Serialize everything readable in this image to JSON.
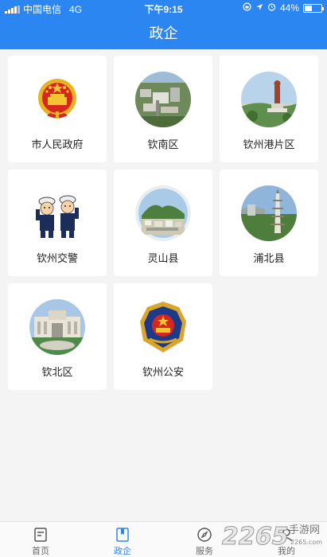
{
  "status_bar": {
    "carrier": "中国电信",
    "network": "4G",
    "time": "下午9:15",
    "battery_text": "44%",
    "battery_level": 0.44
  },
  "header": {
    "title": "政企"
  },
  "grid": {
    "items": [
      {
        "label": "市人民政府",
        "icon": "national-emblem-icon"
      },
      {
        "label": "钦南区",
        "icon": "aerial-city-photo"
      },
      {
        "label": "钦州港片区",
        "icon": "statue-photo"
      },
      {
        "label": "钦州交警",
        "icon": "traffic-police-cartoon"
      },
      {
        "label": "灵山县",
        "icon": "town-mountain-photo"
      },
      {
        "label": "浦北县",
        "icon": "pagoda-photo"
      },
      {
        "label": "钦北区",
        "icon": "government-building-photo"
      },
      {
        "label": "钦州公安",
        "icon": "police-badge-icon"
      }
    ]
  },
  "tab_bar": {
    "tabs": [
      {
        "label": "首页",
        "icon": "home-doc-icon",
        "active": false
      },
      {
        "label": "政企",
        "icon": "bookmark-book-icon",
        "active": true
      },
      {
        "label": "服务",
        "icon": "compass-icon",
        "active": false
      },
      {
        "label": "我的",
        "icon": "person-icon",
        "active": false
      }
    ]
  },
  "watermark": {
    "logo_text": "2265",
    "site_text": "手游网",
    "url": "2265.com"
  },
  "colors": {
    "accent": "#2b86f2",
    "background": "#f4f4f4",
    "card": "#ffffff"
  }
}
